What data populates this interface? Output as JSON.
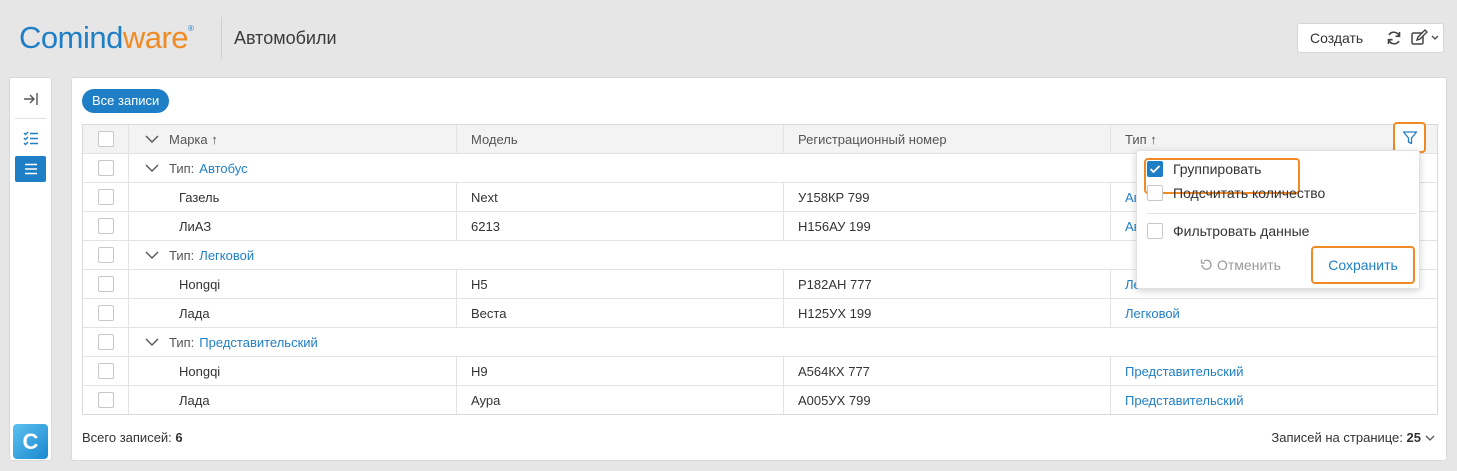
{
  "header": {
    "logo_part1": "Comind",
    "logo_part2": "ware",
    "logo_reg": "®",
    "page_title": "Автомобили",
    "create_label": "Создать"
  },
  "rail": {
    "logo_letter": "C"
  },
  "main": {
    "view_button": "Все записи",
    "columns": [
      "Марка ↑",
      "Модель",
      "Регистрационный номер",
      "Тип ↑"
    ],
    "group_prefix": "Тип:",
    "groups": [
      {
        "name": "Автобус",
        "rows": [
          {
            "make": "Газель",
            "model": "Next",
            "reg": "У158КР 799",
            "type": "Ав"
          },
          {
            "make": "ЛиАЗ",
            "model": "6213",
            "reg": "Н156АУ 199",
            "type": "Ав"
          }
        ]
      },
      {
        "name": "Легковой",
        "rows": [
          {
            "make": "Hongqi",
            "model": "H5",
            "reg": "Р182АН 777",
            "type": "Ле"
          },
          {
            "make": "Лада",
            "model": "Веста",
            "reg": "Н125УХ 199",
            "type": "Легковой"
          }
        ]
      },
      {
        "name": "Представительский",
        "rows": [
          {
            "make": "Hongqi",
            "model": "H9",
            "reg": "А564КХ 777",
            "type": "Представительский"
          },
          {
            "make": "Лада",
            "model": "Аура",
            "reg": "А005УХ 799",
            "type": "Представительский"
          }
        ]
      }
    ],
    "total_label": "Всего записей:",
    "total_value": "6",
    "per_page_label": "Записей на странице:",
    "per_page_value": "25"
  },
  "popup": {
    "group_label": "Группировать",
    "group_checked": true,
    "count_label": "Подсчитать количество",
    "filter_label": "Фильтровать данные",
    "cancel_label": "Отменить",
    "save_label": "Сохранить"
  },
  "colors": {
    "accent": "#1f7fc6",
    "highlight": "#f08a24"
  }
}
